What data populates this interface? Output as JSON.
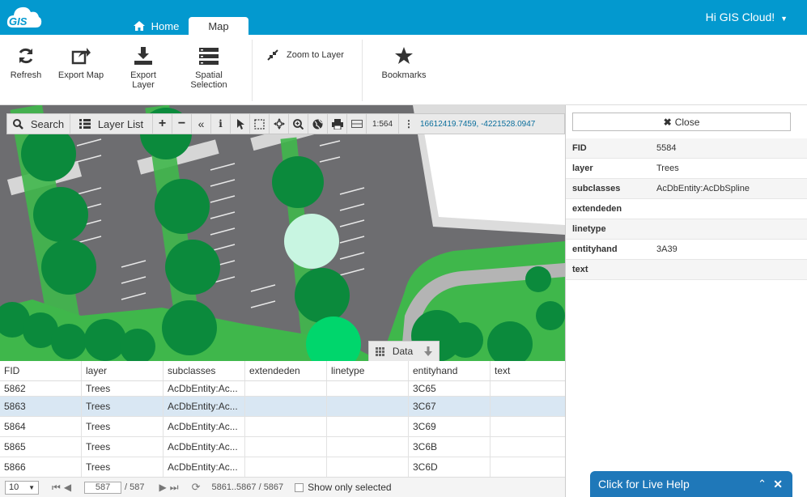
{
  "header": {
    "logo_text": "GIS",
    "tabs": [
      {
        "label": "Home",
        "icon": "home-icon"
      },
      {
        "label": "Map"
      }
    ],
    "greeting": "Hi GIS Cloud!"
  },
  "ribbon": {
    "refresh": "Refresh",
    "export_map": "Export Map",
    "export_layer_1": "Export",
    "export_layer_2": "Layer",
    "spatial_1": "Spatial",
    "spatial_2": "Selection",
    "zoom_to_layer": "Zoom to Layer",
    "bookmarks": "Bookmarks"
  },
  "map_toolbar": {
    "search": "Search",
    "layer_list": "Layer List",
    "scale": "1:564",
    "coordinates": "16612419.7459, -4221528.0947"
  },
  "data_tab": {
    "label": "Data"
  },
  "side_panel": {
    "close_label": "Close",
    "attributes": [
      {
        "key": "FID",
        "value": "5584"
      },
      {
        "key": "layer",
        "value": "Trees"
      },
      {
        "key": "subclasses",
        "value": "AcDbEntity:AcDbSpline"
      },
      {
        "key": "extendeden",
        "value": ""
      },
      {
        "key": "linetype",
        "value": ""
      },
      {
        "key": "entityhand",
        "value": "3A39"
      },
      {
        "key": "text",
        "value": ""
      }
    ]
  },
  "table": {
    "columns": [
      "FID",
      "layer",
      "subclasses",
      "extendeden",
      "linetype",
      "entityhand",
      "text"
    ],
    "rows": [
      [
        "5862",
        "Trees",
        "AcDbEntity:Ac...",
        "",
        "",
        "3C65",
        ""
      ],
      [
        "5863",
        "Trees",
        "AcDbEntity:Ac...",
        "",
        "",
        "3C67",
        ""
      ],
      [
        "5864",
        "Trees",
        "AcDbEntity:Ac...",
        "",
        "",
        "3C69",
        ""
      ],
      [
        "5865",
        "Trees",
        "AcDbEntity:Ac...",
        "",
        "",
        "3C6B",
        ""
      ],
      [
        "5866",
        "Trees",
        "AcDbEntity:Ac...",
        "",
        "",
        "3C6D",
        ""
      ]
    ],
    "selected_row_index": 1
  },
  "pager": {
    "page_size": "10",
    "current_page": "587",
    "total_pages": "/ 587",
    "range": "5861..5867 / 5867",
    "show_only_selected": "Show only selected"
  },
  "live_help": {
    "label": "Click for Live Help"
  },
  "colors": {
    "header": "#0399cf",
    "selected_row": "#d9e7f3",
    "live_help": "#1f78b9",
    "tree_dark": "#0b8a3c",
    "tree_selected": "#c8f5e1"
  }
}
